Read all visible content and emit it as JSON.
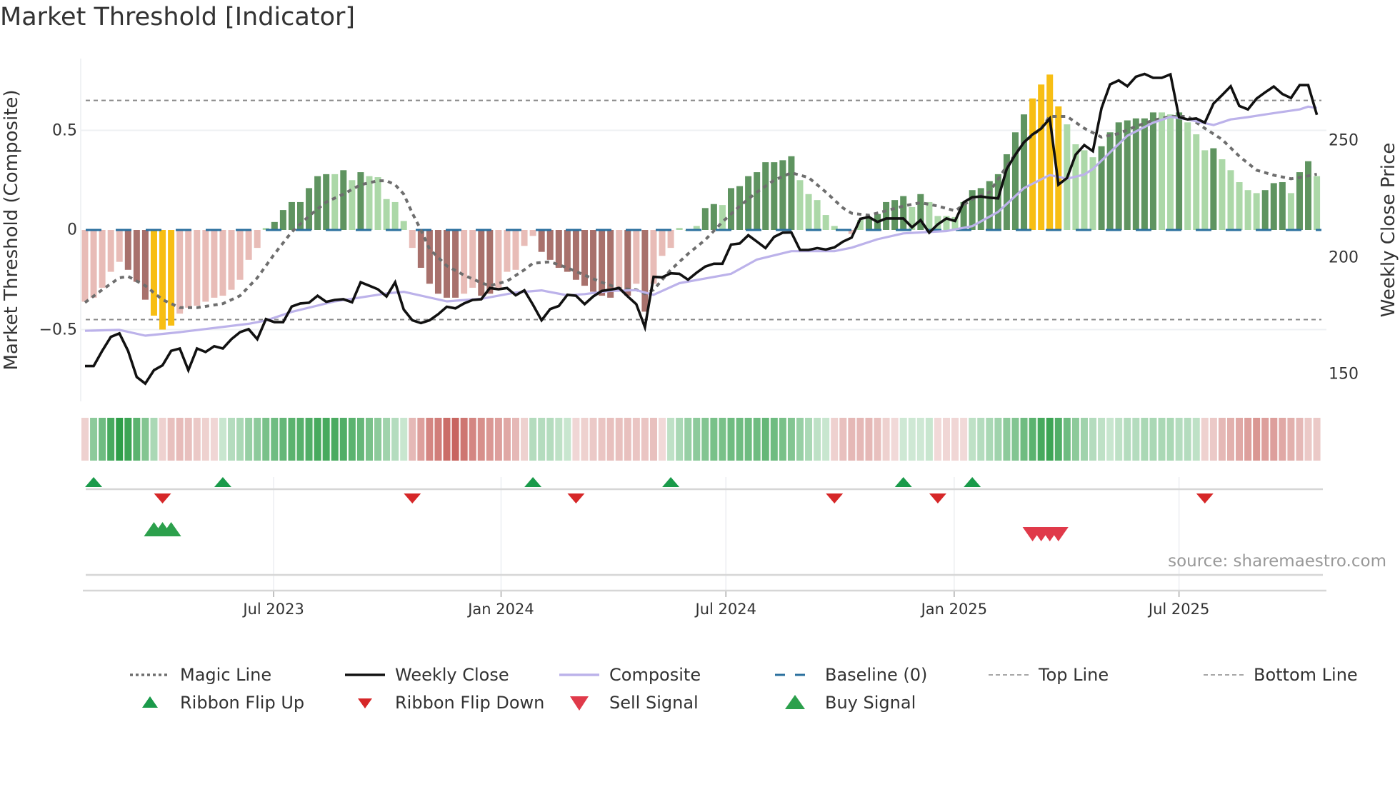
{
  "title": "Market Threshold [Indicator]",
  "source": "source: sharemaestro.com",
  "colors": {
    "light_red": "#e8bcb7",
    "dark_red": "#a8716c",
    "light_green": "#acd8a8",
    "dark_green": "#5f9460",
    "yellow": "#f7be14",
    "baseline": "#2a6f9e",
    "magic": "#6e6e6e",
    "composite": "#bcb2ea",
    "close": "#111111",
    "threshold_lines": "#888888",
    "ribbon_green": "#2e9e48",
    "ribbon_red": "#c0504a",
    "flip_up": "#1a9a4a",
    "flip_down": "#d62728",
    "sell": "#e03a4a",
    "buy": "#2ca04c"
  },
  "chart_data": {
    "type": "bar",
    "title": "Market Threshold [Indicator]",
    "ylabel": "Market Threshold (Composite)",
    "ylabel_right": "Weekly Close Price",
    "x_unit": "week index (1 = first weekly bar)",
    "ylim": [
      -0.86,
      0.86
    ],
    "ylim_right": [
      140,
      290
    ],
    "y_ticks": [
      {
        "label": "0.5",
        "value": 0.5
      },
      {
        "label": "0",
        "value": 0
      },
      {
        "label": "−0.5",
        "value": -0.5
      }
    ],
    "y_ticks_right": [
      {
        "label": "250",
        "value": 250
      },
      {
        "label": "200",
        "value": 200
      },
      {
        "label": "150",
        "value": 150
      }
    ],
    "x_ticks": [
      {
        "label": "Jul 2023",
        "week": 22.9
      },
      {
        "label": "Jan 2024",
        "week": 49.3
      },
      {
        "label": "Jul 2024",
        "week": 75.4
      },
      {
        "label": "Jan 2025",
        "week": 101.9
      },
      {
        "label": "Jul 2025",
        "week": 128.0
      }
    ],
    "top_line": 0.65,
    "bottom_line": -0.45,
    "baseline": 0,
    "composite_bars": [
      -0.36,
      -0.34,
      -0.29,
      -0.21,
      -0.16,
      -0.2,
      -0.26,
      -0.35,
      -0.43,
      -0.5,
      -0.48,
      -0.42,
      -0.39,
      -0.38,
      -0.36,
      -0.34,
      -0.33,
      -0.3,
      -0.25,
      -0.15,
      -0.09,
      0.01,
      0.04,
      0.1,
      0.14,
      0.14,
      0.21,
      0.27,
      0.28,
      0.28,
      0.3,
      0.25,
      0.29,
      0.27,
      0.265,
      0.155,
      0.14,
      0.045,
      -0.09,
      -0.19,
      -0.27,
      -0.32,
      -0.34,
      -0.34,
      -0.32,
      -0.29,
      -0.33,
      -0.32,
      -0.29,
      -0.21,
      -0.2,
      -0.08,
      -0.03,
      -0.11,
      -0.15,
      -0.19,
      -0.21,
      -0.25,
      -0.28,
      -0.31,
      -0.33,
      -0.34,
      -0.3,
      -0.33,
      -0.27,
      -0.41,
      -0.27,
      -0.13,
      -0.09,
      0.01,
      0.0,
      0.02,
      0.11,
      0.13,
      0.125,
      0.21,
      0.22,
      0.27,
      0.29,
      0.34,
      0.34,
      0.35,
      0.37,
      0.25,
      0.18,
      0.15,
      0.075,
      0.02,
      0.005,
      -0.02,
      0.05,
      0.06,
      0.08,
      0.14,
      0.15,
      0.17,
      0.115,
      0.18,
      0.14,
      0.07,
      0.07,
      0.065,
      0.14,
      0.2,
      0.21,
      0.245,
      0.28,
      0.38,
      0.49,
      0.58,
      0.66,
      0.73,
      0.78,
      0.62,
      0.53,
      0.43,
      0.4,
      0.365,
      0.42,
      0.49,
      0.54,
      0.55,
      0.56,
      0.56,
      0.59,
      0.59,
      0.58,
      0.59,
      0.54,
      0.48,
      0.4,
      0.41,
      0.355,
      0.3,
      0.24,
      0.2,
      0.185,
      0.2,
      0.235,
      0.24,
      0.185,
      0.29,
      0.345,
      0.27
    ],
    "bar_shade_runs": [
      [
        "r",
        5
      ],
      [
        "R",
        3
      ],
      [
        "Y",
        3
      ],
      [
        "r",
        10
      ],
      [
        "g",
        1
      ],
      [
        "G",
        7
      ],
      [
        "g",
        1
      ],
      [
        "G",
        1
      ],
      [
        "g",
        1
      ],
      [
        "G",
        1
      ],
      [
        "g",
        5
      ],
      [
        "r",
        1
      ],
      [
        "R",
        5
      ],
      [
        "r",
        2
      ],
      [
        "R",
        2
      ],
      [
        "r",
        5
      ],
      [
        "R",
        9
      ],
      [
        "r",
        1
      ],
      [
        "R",
        1
      ],
      [
        "r",
        1
      ],
      [
        "R",
        1
      ],
      [
        "r",
        3
      ],
      [
        "g",
        3
      ],
      [
        "G",
        2
      ],
      [
        "g",
        1
      ],
      [
        "G",
        8
      ],
      [
        "g",
        6
      ],
      [
        "r",
        1
      ],
      [
        "g",
        1
      ],
      [
        "G",
        5
      ],
      [
        "g",
        1
      ],
      [
        "G",
        1
      ],
      [
        "g",
        4
      ],
      [
        "G",
        8
      ],
      [
        "Y",
        4
      ],
      [
        "g",
        4
      ],
      [
        "G",
        7
      ],
      [
        "g",
        2
      ],
      [
        "G",
        1
      ],
      [
        "g",
        3
      ],
      [
        "G",
        1
      ],
      [
        "g",
        5
      ],
      [
        "G",
        3
      ],
      [
        "g",
        1
      ],
      [
        "G",
        2
      ],
      [
        "g",
        1
      ]
    ],
    "weekly_close": [
      153.5,
      153.5,
      160,
      166,
      167.5,
      160,
      148.8,
      146,
      151.7,
      153.8,
      160,
      161,
      151.7,
      161,
      159.5,
      162,
      161,
      165,
      168,
      169.3,
      165,
      173.6,
      172.3,
      172.3,
      179,
      180.3,
      180.6,
      183.6,
      181,
      181.8,
      182.1,
      180.8,
      189.4,
      187.9,
      186.4,
      183.3,
      189.4,
      177.7,
      173.1,
      171.9,
      173.1,
      175.7,
      178.9,
      178.2,
      180.3,
      181.8,
      182.1,
      186.9,
      186.4,
      186.9,
      183.8,
      185.9,
      179.8,
      173.1,
      177.9,
      179.2,
      184,
      183.6,
      180,
      183.3,
      185.7,
      186.2,
      186.9,
      183.3,
      180,
      170.1,
      191.7,
      191.5,
      193.2,
      193,
      190.5,
      193.5,
      196.1,
      197.3,
      197.3,
      205.5,
      206,
      209.5,
      206.8,
      204,
      208.8,
      210.6,
      210.7,
      203.2,
      203.2,
      204,
      203.4,
      204.3,
      206.8,
      208.5,
      216.5,
      217.3,
      215.2,
      216.7,
      216.7,
      216.7,
      212.9,
      216,
      210.6,
      214.2,
      216.7,
      215.6,
      223.6,
      225.8,
      226.1,
      225.6,
      225.3,
      237.9,
      244,
      249.3,
      252.7,
      255.2,
      259.5,
      231.2,
      234,
      244,
      248.1,
      245.5,
      263.9,
      274.1,
      275.8,
      273.3,
      277.4,
      278.6,
      276.9,
      276.9,
      278.4,
      260.1,
      259.1,
      259.5,
      257.7,
      265.9,
      269.5,
      273.3,
      264.9,
      263.4,
      268,
      270.7,
      273.2,
      270,
      268.3,
      273.8,
      273.8,
      261.1
    ],
    "composite_line": [
      [
        1,
        168.6
      ],
      [
        5,
        169
      ],
      [
        8,
        166.5
      ],
      [
        12,
        168
      ],
      [
        20,
        171.6
      ],
      [
        22,
        173
      ],
      [
        25,
        176.7
      ],
      [
        30,
        181.2
      ],
      [
        36,
        184.6
      ],
      [
        38,
        185.3
      ],
      [
        43,
        181.2
      ],
      [
        47,
        182.3
      ],
      [
        51,
        185
      ],
      [
        54,
        185.9
      ],
      [
        57,
        183.8
      ],
      [
        59,
        184.3
      ],
      [
        62,
        185.7
      ],
      [
        65,
        186
      ],
      [
        67,
        184
      ],
      [
        70,
        189
      ],
      [
        73,
        191
      ],
      [
        76,
        193
      ],
      [
        79,
        199.1
      ],
      [
        83,
        202.7
      ],
      [
        88,
        202.7
      ],
      [
        90,
        204.2
      ],
      [
        93,
        207.8
      ],
      [
        96,
        210.3
      ],
      [
        101,
        211.3
      ],
      [
        104,
        213.4
      ],
      [
        107,
        219.5
      ],
      [
        110,
        229.7
      ],
      [
        113,
        235.3
      ],
      [
        115,
        233.7
      ],
      [
        117,
        235.5
      ],
      [
        118,
        237.9
      ],
      [
        120,
        245
      ],
      [
        122,
        252.1
      ],
      [
        125,
        257.7
      ],
      [
        127,
        260.2
      ],
      [
        129,
        259.1
      ],
      [
        132,
        256.7
      ],
      [
        134,
        259.1
      ],
      [
        136,
        260.1
      ],
      [
        139,
        261.8
      ],
      [
        142,
        263.4
      ],
      [
        143,
        264.6
      ],
      [
        144,
        264
      ]
    ],
    "magic_line": [
      [
        1,
        -0.364
      ],
      [
        3,
        -0.3
      ],
      [
        5,
        -0.24
      ],
      [
        6,
        -0.233
      ],
      [
        8,
        -0.28
      ],
      [
        10,
        -0.35
      ],
      [
        12,
        -0.39
      ],
      [
        14,
        -0.39
      ],
      [
        17,
        -0.37
      ],
      [
        19,
        -0.33
      ],
      [
        21,
        -0.24
      ],
      [
        23,
        -0.12
      ],
      [
        25,
        -0.01
      ],
      [
        27,
        0.07
      ],
      [
        29,
        0.14
      ],
      [
        31,
        0.18
      ],
      [
        33,
        0.227
      ],
      [
        35,
        0.247
      ],
      [
        36,
        0.247
      ],
      [
        37,
        0.227
      ],
      [
        38,
        0.18
      ],
      [
        39,
        0.084
      ],
      [
        40,
        0
      ],
      [
        41,
        -0.096
      ],
      [
        43,
        -0.18
      ],
      [
        45,
        -0.227
      ],
      [
        47,
        -0.265
      ],
      [
        48,
        -0.28
      ],
      [
        50,
        -0.257
      ],
      [
        52,
        -0.2
      ],
      [
        53,
        -0.167
      ],
      [
        55,
        -0.16
      ],
      [
        57,
        -0.19
      ],
      [
        59,
        -0.227
      ],
      [
        61,
        -0.263
      ],
      [
        63,
        -0.293
      ],
      [
        65,
        -0.3
      ],
      [
        66,
        -0.32
      ],
      [
        67,
        -0.3
      ],
      [
        69,
        -0.2
      ],
      [
        71,
        -0.12
      ],
      [
        73,
        -0.05
      ],
      [
        75,
        0.04
      ],
      [
        77,
        0.12
      ],
      [
        79,
        0.19
      ],
      [
        81,
        0.25
      ],
      [
        83,
        0.287
      ],
      [
        85,
        0.263
      ],
      [
        87,
        0.19
      ],
      [
        89,
        0.11
      ],
      [
        90,
        0.084
      ],
      [
        92,
        0.074
      ],
      [
        94,
        0.096
      ],
      [
        96,
        0.12
      ],
      [
        98,
        0.137
      ],
      [
        100,
        0.12
      ],
      [
        102,
        0.096
      ],
      [
        104,
        0.155
      ],
      [
        106,
        0.19
      ],
      [
        108,
        0.32
      ],
      [
        110,
        0.44
      ],
      [
        112,
        0.51
      ],
      [
        113,
        0.57
      ],
      [
        115,
        0.57
      ],
      [
        117,
        0.51
      ],
      [
        119,
        0.466
      ],
      [
        121,
        0.484
      ],
      [
        123,
        0.52
      ],
      [
        125,
        0.55
      ],
      [
        127,
        0.57
      ],
      [
        129,
        0.57
      ],
      [
        131,
        0.51
      ],
      [
        133,
        0.454
      ],
      [
        135,
        0.37
      ],
      [
        137,
        0.3
      ],
      [
        139,
        0.275
      ],
      [
        141,
        0.257
      ],
      [
        142,
        0.263
      ],
      [
        144,
        0.28
      ]
    ],
    "ribbon": [
      -0.15,
      0.45,
      0.6,
      0.8,
      0.95,
      0.85,
      0.7,
      0.5,
      0.3,
      -0.15,
      -0.25,
      -0.28,
      -0.25,
      -0.2,
      -0.15,
      -0.12,
      0.15,
      0.25,
      0.3,
      0.4,
      0.45,
      0.55,
      0.6,
      0.65,
      0.7,
      0.72,
      0.75,
      0.8,
      0.8,
      0.78,
      0.75,
      0.7,
      0.65,
      0.55,
      0.45,
      0.35,
      0.25,
      0.15,
      -0.3,
      -0.45,
      -0.6,
      -0.65,
      -0.75,
      -0.8,
      -0.7,
      -0.6,
      -0.55,
      -0.5,
      -0.45,
      -0.4,
      -0.3,
      -0.15,
      0.25,
      0.25,
      0.25,
      0.2,
      0.15,
      -0.12,
      -0.15,
      -0.2,
      -0.22,
      -0.25,
      -0.25,
      -0.25,
      -0.22,
      -0.22,
      -0.25,
      -0.1,
      0.2,
      0.3,
      0.4,
      0.45,
      0.5,
      0.55,
      0.55,
      0.6,
      0.6,
      0.6,
      0.6,
      0.65,
      0.6,
      0.55,
      0.5,
      0.4,
      0.3,
      0.2,
      0.15,
      -0.15,
      -0.25,
      -0.3,
      -0.3,
      -0.3,
      -0.25,
      -0.15,
      -0.1,
      0.12,
      0.12,
      0.12,
      0.15,
      -0.1,
      -0.12,
      -0.12,
      -0.1,
      0.2,
      0.25,
      0.3,
      0.35,
      0.45,
      0.5,
      0.6,
      0.7,
      0.8,
      0.85,
      0.75,
      0.6,
      0.45,
      0.35,
      0.25,
      0.2,
      0.15,
      0.2,
      0.25,
      0.25,
      0.3,
      0.3,
      0.3,
      0.3,
      0.25,
      0.25,
      0.2,
      -0.15,
      -0.2,
      -0.3,
      -0.35,
      -0.4,
      -0.45,
      -0.5,
      -0.45,
      -0.45,
      -0.4,
      -0.35,
      -0.3,
      -0.2,
      -0.2
    ],
    "ribbon_flip_up_weeks": [
      2,
      17,
      53,
      69,
      96,
      104
    ],
    "ribbon_flip_down_weeks": [
      10,
      39,
      58,
      88,
      100,
      131
    ],
    "buy_signal_weeks": [
      9,
      10,
      11
    ],
    "sell_signal_weeks": [
      111,
      112,
      113,
      114
    ]
  },
  "legend": [
    {
      "label": "Magic Line",
      "icon": "dotted-line"
    },
    {
      "label": "Weekly Close",
      "icon": "solid-line-black"
    },
    {
      "label": "Composite",
      "icon": "solid-line-lavender"
    },
    {
      "label": "Baseline (0)",
      "icon": "dashed-line-blue"
    },
    {
      "label": "Top Line",
      "icon": "dashed-line-grey"
    },
    {
      "label": "Bottom Line",
      "icon": "dashed-line-grey"
    },
    {
      "label": "Ribbon Flip Up",
      "icon": "triangle-up-green"
    },
    {
      "label": "Ribbon Flip Down",
      "icon": "triangle-down-red"
    },
    {
      "label": "Sell Signal",
      "icon": "triangle-down-red"
    },
    {
      "label": "Buy Signal",
      "icon": "triangle-up-green"
    }
  ]
}
